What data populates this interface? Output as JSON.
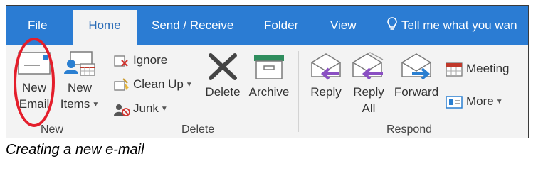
{
  "tabs": {
    "file": "File",
    "home": "Home",
    "send_receive": "Send / Receive",
    "folder": "Folder",
    "view": "View",
    "tell_me": "Tell me what you wan"
  },
  "groups": {
    "new": {
      "label": "New",
      "new_email_line1": "New",
      "new_email_line2": "Email",
      "new_items_line1": "New",
      "new_items_line2": "Items"
    },
    "delete": {
      "label": "Delete",
      "ignore": "Ignore",
      "clean_up": "Clean Up",
      "junk": "Junk",
      "delete_button": "Delete",
      "archive_button": "Archive"
    },
    "respond": {
      "label": "Respond",
      "reply": "Reply",
      "reply_all_line1": "Reply",
      "reply_all_line2": "All",
      "forward": "Forward",
      "meeting": "Meeting",
      "more": "More"
    }
  },
  "caption": "Creating a new e-mail",
  "colors": {
    "tab_bar": "#2b7cd3",
    "highlight_circle": "#e41e2b",
    "arrow_purple": "#8a4fc3",
    "arrow_blue": "#2a7fd1"
  }
}
